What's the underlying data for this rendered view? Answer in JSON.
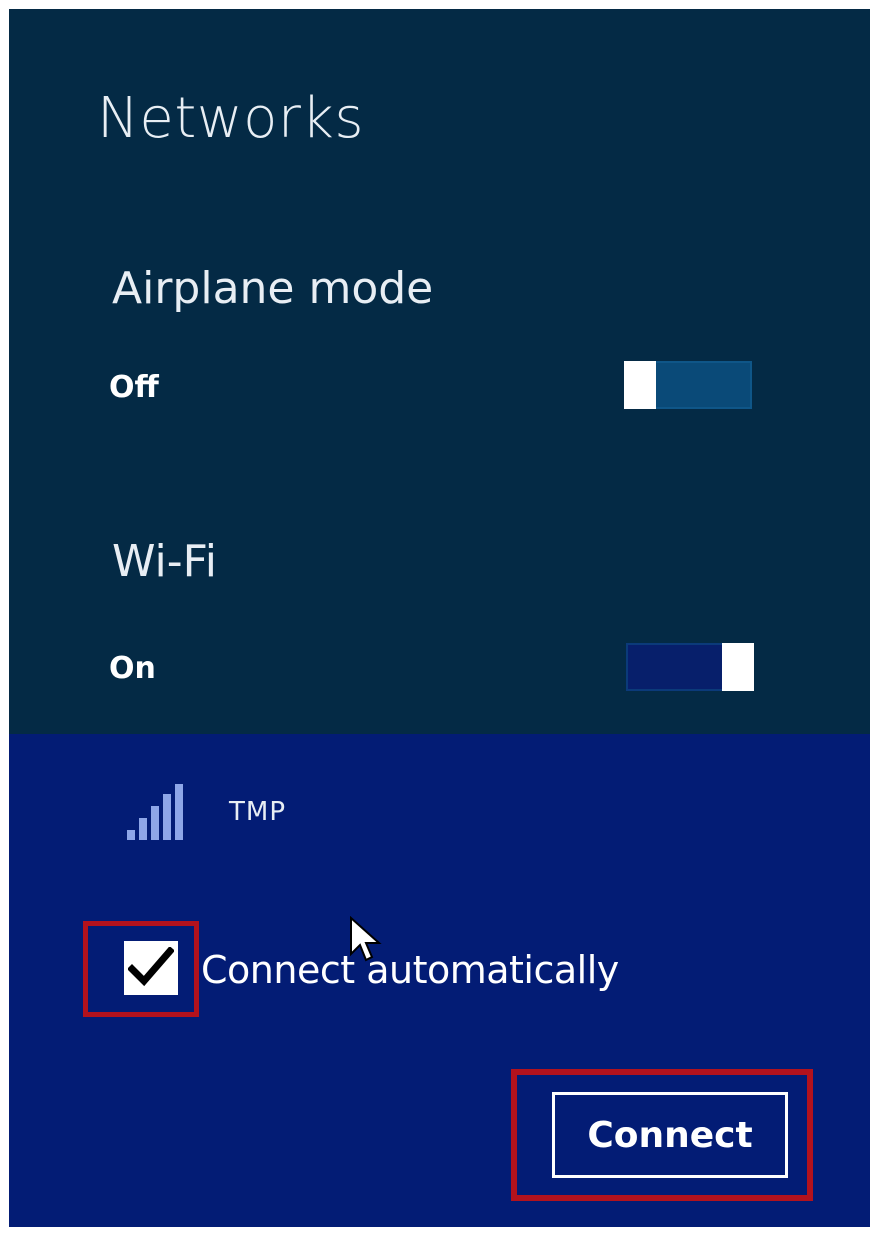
{
  "panel": {
    "title": "Networks"
  },
  "airplane_mode": {
    "label": "Airplane mode",
    "state": "Off"
  },
  "wifi": {
    "label": "Wi-Fi",
    "state": "On"
  },
  "network": {
    "icon": "wifi-signal-icon",
    "name": "TMP",
    "connect_automatically": {
      "label": "Connect automatically",
      "checked": true
    },
    "connect_button": "Connect"
  },
  "colors": {
    "top_panel": "#042a45",
    "network_panel": "#031c75",
    "highlight": "#b3121d"
  }
}
